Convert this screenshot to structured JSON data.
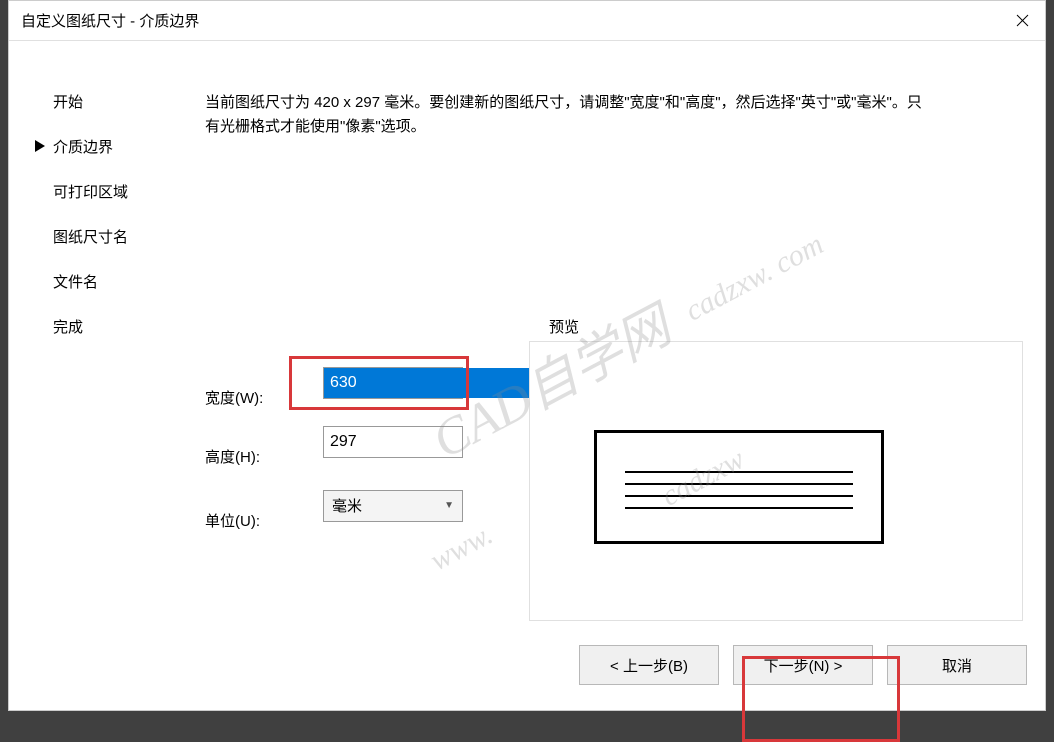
{
  "title": "自定义图纸尺寸 - 介质边界",
  "nav": {
    "items": [
      {
        "label": "开始"
      },
      {
        "label": "介质边界"
      },
      {
        "label": "可打印区域"
      },
      {
        "label": "图纸尺寸名"
      },
      {
        "label": "文件名"
      },
      {
        "label": "完成"
      }
    ],
    "active_index": 1
  },
  "description": "当前图纸尺寸为 420 x 297 毫米。要创建新的图纸尺寸，请调整\"宽度\"和\"高度\"，然后选择\"英寸\"或\"毫米\"。只有光栅格式才能使用\"像素\"选项。",
  "form": {
    "width_label": "宽度(W):",
    "width_value": "630",
    "height_label": "高度(H):",
    "height_value": "297",
    "unit_label": "单位(U):",
    "unit_value": "毫米"
  },
  "preview_label": "预览",
  "buttons": {
    "back": "< 上一步(B)",
    "next": "下一步(N) >",
    "cancel": "取消"
  },
  "watermarks": {
    "main": "CAD自学网",
    "url1": "cadzxw. com",
    "url2": "www.",
    "url3": "cadzxw"
  }
}
